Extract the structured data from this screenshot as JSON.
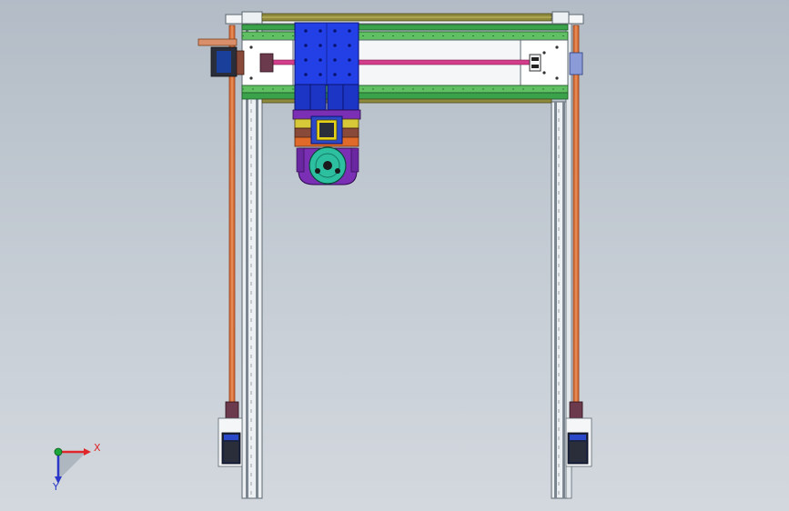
{
  "view": {
    "background": "#c3cad2"
  },
  "axes": {
    "x": {
      "label": "X",
      "color": "#e0262b"
    },
    "y": {
      "label": "Y",
      "color": "#2b37c8"
    },
    "origin_color": "#1aa63a"
  },
  "colors": {
    "frame_white": "#f4f6f8",
    "extrusion_gray": "#c7ced4",
    "extrusion_edge": "#5d6870",
    "rail_green": "#3aa24a",
    "rail_olive": "#8f8a3c",
    "carriage_blue": "#2240e6",
    "lead_screw_pink": "#d43c8c",
    "rod_orange": "#d9703a",
    "motor_dark": "#2a2d3a",
    "motor_blue": "#2a48c8",
    "gear_teal": "#2cbfa0",
    "housing_purple": "#7a2fb4",
    "block_brown": "#8a4a3a",
    "accent_yellow": "#e7d21a"
  }
}
